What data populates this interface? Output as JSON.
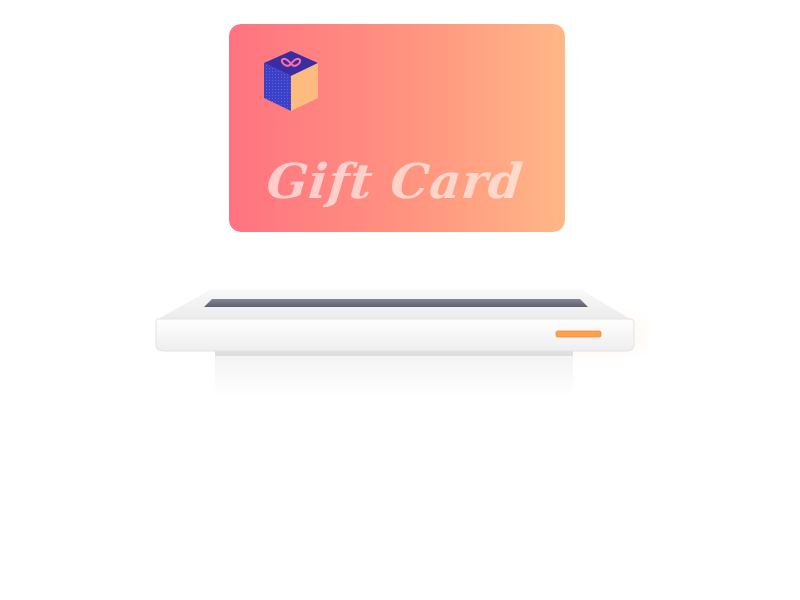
{
  "gift_card": {
    "title": "Gift Card",
    "gradient_start": "#ff7382",
    "gradient_end": "#ffb688"
  },
  "gift_box_icon": {
    "name": "gift-box-icon",
    "top_color": "#3b2ea6",
    "left_color": "#3a41c6",
    "right_color": "#fdba7e",
    "ribbon_color": "#ff6aa0"
  },
  "terminal": {
    "slot_color": "#6b6f80",
    "indicator_light_color": "#ffa04a"
  }
}
